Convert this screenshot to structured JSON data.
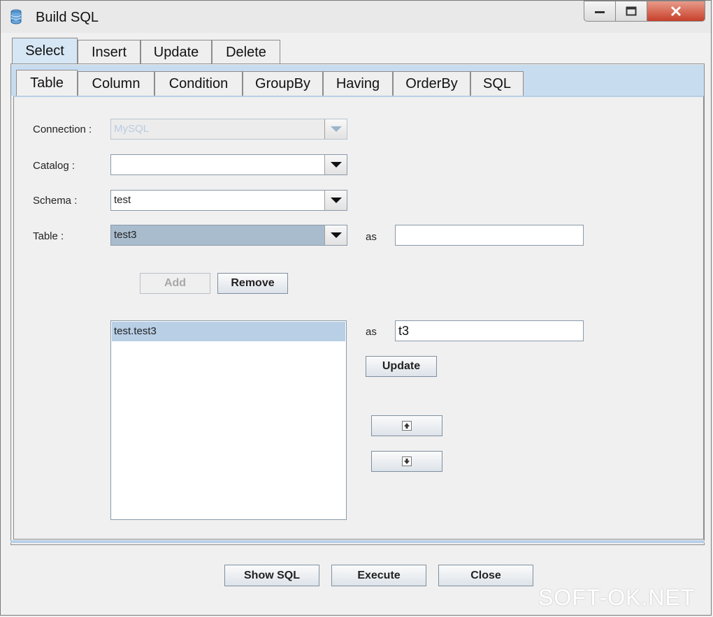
{
  "window": {
    "title": "Build SQL",
    "icon": "database-icon"
  },
  "main_tabs": [
    {
      "label": "Select",
      "active": true
    },
    {
      "label": "Insert",
      "active": false
    },
    {
      "label": "Update",
      "active": false
    },
    {
      "label": "Delete",
      "active": false
    }
  ],
  "sub_tabs": [
    {
      "label": "Table",
      "active": true
    },
    {
      "label": "Column",
      "active": false
    },
    {
      "label": "Condition",
      "active": false
    },
    {
      "label": "GroupBy",
      "active": false
    },
    {
      "label": "Having",
      "active": false
    },
    {
      "label": "OrderBy",
      "active": false
    },
    {
      "label": "SQL",
      "active": false
    }
  ],
  "form": {
    "connection": {
      "label": "Connection :",
      "value": "MySQL",
      "enabled": false
    },
    "catalog": {
      "label": "Catalog :",
      "value": ""
    },
    "schema": {
      "label": "Schema :",
      "value": "test"
    },
    "table": {
      "label": "Table :",
      "value": "test3",
      "alias_label": "as",
      "alias_value": ""
    }
  },
  "buttons": {
    "add": "Add",
    "remove": "Remove",
    "update": "Update",
    "show_sql": "Show SQL",
    "execute": "Execute",
    "close": "Close"
  },
  "selected_tables": {
    "items": [
      "test.test3"
    ],
    "alias_label": "as",
    "alias_value": "t3"
  },
  "watermark": "SOFT-OK.NET",
  "colors": {
    "tab_active": "#d6e6f5",
    "selection": "#b8cfe6",
    "close_button": "#c7402a"
  }
}
